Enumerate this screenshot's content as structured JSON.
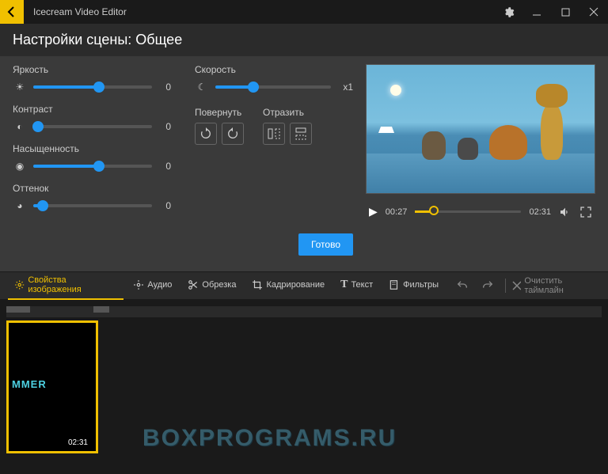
{
  "titlebar": {
    "app_name": "Icecream Video Editor"
  },
  "scene": {
    "title": "Настройки сцены: Общее"
  },
  "sliders": {
    "brightness": {
      "label": "Яркость",
      "value": "0",
      "pos": 55
    },
    "contrast": {
      "label": "Контраст",
      "value": "0",
      "pos": 4
    },
    "saturation": {
      "label": "Насыщенность",
      "value": "0",
      "pos": 55
    },
    "hue": {
      "label": "Оттенок",
      "value": "0",
      "pos": 8
    },
    "speed": {
      "label": "Скорость",
      "value": "x1",
      "pos": 33
    }
  },
  "rotate": {
    "label": "Повернуть"
  },
  "flip": {
    "label": "Отразить"
  },
  "done": {
    "label": "Готово"
  },
  "player": {
    "current": "00:27",
    "total": "02:31",
    "progress": 18
  },
  "toolbar": {
    "props": "Свойства изображения",
    "audio": "Аудио",
    "trim": "Обрезка",
    "crop": "Кадрирование",
    "text": "Текст",
    "filters": "Фильтры",
    "clear": "Очистить таймлайн"
  },
  "clip": {
    "overlay": "MMER",
    "duration": "02:31"
  },
  "watermark": "BOXPROGRAMS.RU"
}
